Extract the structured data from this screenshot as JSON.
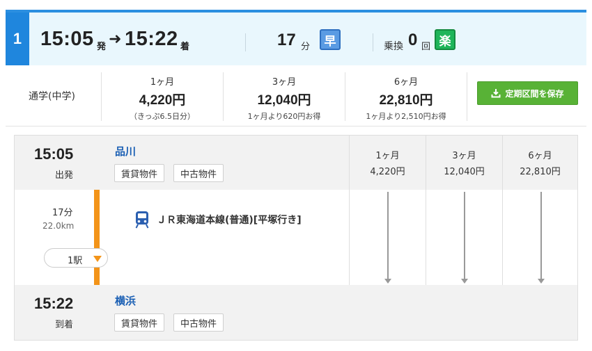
{
  "route": {
    "number": "1",
    "departure_time": "15:05",
    "departure_suffix": "発",
    "arrow": "➜",
    "arrival_time": "15:22",
    "arrival_suffix": "着",
    "duration_value": "17",
    "duration_unit": "分",
    "fast_badge": "早",
    "transfer_label": "乗換",
    "transfer_value": "0",
    "transfer_unit": "回",
    "easy_badge": "楽"
  },
  "fare_summary": {
    "ticket_type": "通学(中学)",
    "columns": [
      {
        "period": "1ヶ月",
        "price": "4,220円",
        "note": "（きっぷ6.5日分）"
      },
      {
        "period": "3ヶ月",
        "price": "12,040円",
        "note": "1ヶ月より620円お得"
      },
      {
        "period": "6ヶ月",
        "price": "22,810円",
        "note": "1ヶ月より2,510円お得"
      }
    ],
    "save_button_label": "定期区間を保存",
    "save_icon": "download-icon"
  },
  "detail": {
    "departure": {
      "time": "15:05",
      "label": "出発",
      "station": "品川",
      "tags": [
        "賃貸物件",
        "中古物件"
      ]
    },
    "segment": {
      "duration": "17分",
      "distance": "22.0km",
      "stops": "1駅",
      "line_color": "#f39419",
      "train_icon": "train-icon",
      "train_name": "ＪＲ東海道本線(普通)[平塚行き]"
    },
    "arrival": {
      "time": "15:22",
      "label": "到着",
      "station": "横浜",
      "tags": [
        "賃貸物件",
        "中古物件"
      ]
    },
    "fare_columns": [
      {
        "period": "1ヶ月",
        "price": "4,220円"
      },
      {
        "period": "3ヶ月",
        "price": "12,040円"
      },
      {
        "period": "6ヶ月",
        "price": "22,810円"
      }
    ]
  },
  "colors": {
    "accent_blue": "#1f86dd",
    "save_green": "#58b236",
    "station_link": "#1a5fb4"
  }
}
